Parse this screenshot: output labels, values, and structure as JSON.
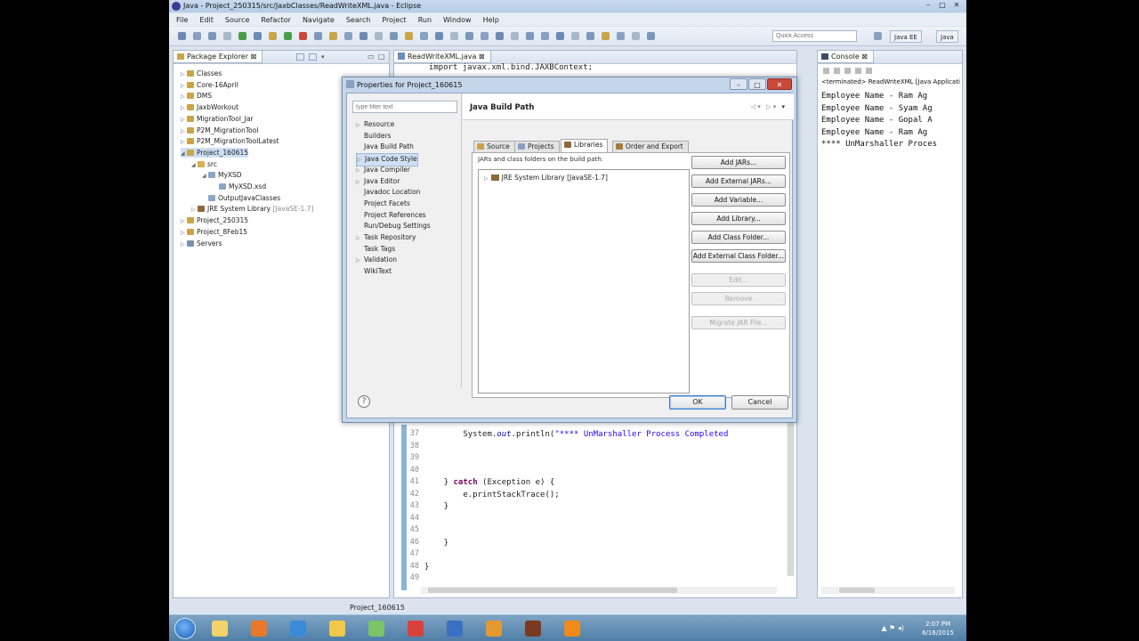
{
  "window": {
    "title": "Java - Project_250315/src/JaxbClasses/ReadWriteXML.java - Eclipse",
    "controls": {
      "minimize": "–",
      "maximize": "□",
      "close": "✕"
    }
  },
  "menu": [
    "File",
    "Edit",
    "Source",
    "Refactor",
    "Navigate",
    "Search",
    "Project",
    "Run",
    "Window",
    "Help"
  ],
  "toolbar": {
    "quick_access_placeholder": "Quick Access",
    "perspectives": [
      "Java EE",
      "Java"
    ]
  },
  "package_explorer": {
    "title": "Package Explorer",
    "items": [
      {
        "label": "Classes",
        "level": 0,
        "arrow": "▷",
        "icon": "project-icon"
      },
      {
        "label": "Core-16April",
        "level": 0,
        "arrow": "▷",
        "icon": "project-icon"
      },
      {
        "label": "DMS",
        "level": 0,
        "arrow": "▷",
        "icon": "project-icon"
      },
      {
        "label": "JaxbWorkout",
        "level": 0,
        "arrow": "▷",
        "icon": "project-icon"
      },
      {
        "label": "MigrationTool_Jar",
        "level": 0,
        "arrow": "▷",
        "icon": "project-icon"
      },
      {
        "label": "P2M_MigrationTool",
        "level": 0,
        "arrow": "▷",
        "icon": "project-icon"
      },
      {
        "label": "P2M_MigrationToolLatest",
        "level": 0,
        "arrow": "▷",
        "icon": "project-icon"
      },
      {
        "label": "Project_160615",
        "level": 0,
        "arrow": "◢",
        "icon": "project-icon",
        "selected": true
      },
      {
        "label": "src",
        "level": 1,
        "arrow": "◢",
        "icon": "source-folder-icon"
      },
      {
        "label": "MyXSD",
        "level": 2,
        "arrow": "◢",
        "icon": "package-icon"
      },
      {
        "label": "MyXSD.xsd",
        "level": 3,
        "arrow": "",
        "icon": "file-icon"
      },
      {
        "label": "OutputJavaClasses",
        "level": 2,
        "arrow": "",
        "icon": "package-icon"
      },
      {
        "label": "JRE System Library",
        "suffix": "[JavaSE-1.7]",
        "level": 1,
        "arrow": "▷",
        "icon": "library-icon"
      },
      {
        "label": "Project_250315",
        "level": 0,
        "arrow": "▷",
        "icon": "project-icon"
      },
      {
        "label": "Project_8Feb15",
        "level": 0,
        "arrow": "▷",
        "icon": "project-icon"
      },
      {
        "label": "Servers",
        "level": 0,
        "arrow": "▷",
        "icon": "server-icon"
      }
    ]
  },
  "editor": {
    "tab_label": "ReadWriteXML.java",
    "top_line": "  import javax.xml.bind.JAXBContext;",
    "lines": [
      {
        "n": "37",
        "parts": [
          [
            "",
            "        System."
          ],
          [
            "fld",
            "out"
          ],
          [
            "",
            ".println("
          ],
          [
            "str",
            "\"**** UnMarshaller Process Completed"
          ]
        ]
      },
      {
        "n": "38",
        "parts": []
      },
      {
        "n": "39",
        "parts": []
      },
      {
        "n": "40",
        "parts": []
      },
      {
        "n": "41",
        "parts": [
          [
            "",
            "    } "
          ],
          [
            "kw",
            "catch"
          ],
          [
            "",
            " (Exception e) {"
          ]
        ]
      },
      {
        "n": "42",
        "parts": [
          [
            "",
            "        e.printStackTrace();"
          ]
        ]
      },
      {
        "n": "43",
        "parts": [
          [
            "",
            "    }"
          ]
        ]
      },
      {
        "n": "44",
        "parts": []
      },
      {
        "n": "45",
        "parts": []
      },
      {
        "n": "46",
        "parts": [
          [
            "",
            "    }"
          ]
        ]
      },
      {
        "n": "47",
        "parts": []
      },
      {
        "n": "48",
        "parts": [
          [
            "",
            "}"
          ]
        ]
      },
      {
        "n": "49",
        "parts": []
      }
    ]
  },
  "console": {
    "title": "Console",
    "header": "<terminated> ReadWriteXML [Java Applicati",
    "lines": [
      "Employee Name - Ram Ag",
      "Employee Name - Syam Ag",
      "Employee Name - Gopal A",
      "Employee Name - Ram Ag",
      "**** UnMarshaller Proces"
    ]
  },
  "status_bar": {
    "text": "Project_160615"
  },
  "taskbar": {
    "time": "2:07 PM",
    "date": "6/16/2015"
  },
  "dialog": {
    "title": "Properties for Project_160615",
    "filter_placeholder": "type filter text",
    "categories": [
      {
        "label": "Resource",
        "arrow": "▷"
      },
      {
        "label": "Builders",
        "arrow": ""
      },
      {
        "label": "Java Build Path",
        "arrow": ""
      },
      {
        "label": "Java Code Style",
        "arrow": "▷",
        "selected": true
      },
      {
        "label": "Java Compiler",
        "arrow": "▷"
      },
      {
        "label": "Java Editor",
        "arrow": "▷"
      },
      {
        "label": "Javadoc Location",
        "arrow": ""
      },
      {
        "label": "Project Facets",
        "arrow": ""
      },
      {
        "label": "Project References",
        "arrow": ""
      },
      {
        "label": "Run/Debug Settings",
        "arrow": ""
      },
      {
        "label": "Task Repository",
        "arrow": "▷"
      },
      {
        "label": "Task Tags",
        "arrow": ""
      },
      {
        "label": "Validation",
        "arrow": "▷"
      },
      {
        "label": "WikiText",
        "arrow": ""
      }
    ],
    "page_title": "Java Build Path",
    "tabs": [
      "Source",
      "Projects",
      "Libraries",
      "Order and Export"
    ],
    "active_tab": "Libraries",
    "panel_label": "JARs and class folders on the build path:",
    "library_item": "JRE System Library [JavaSE-1.7]",
    "buttons": [
      {
        "label": "Add JARs...",
        "enabled": true
      },
      {
        "label": "Add External JARs...",
        "enabled": true
      },
      {
        "label": "Add Variable...",
        "enabled": true
      },
      {
        "label": "Add Library...",
        "enabled": true
      },
      {
        "label": "Add Class Folder...",
        "enabled": true
      },
      {
        "label": "Add External Class Folder...",
        "enabled": true
      },
      {
        "label": "Edit...",
        "enabled": false
      },
      {
        "label": "Remove",
        "enabled": false
      },
      {
        "label": "Migrate JAR File...",
        "enabled": false
      }
    ],
    "help": "?",
    "ok": "OK",
    "cancel": "Cancel"
  },
  "colors": {
    "selection": "#cfe0f5",
    "keyword": "#7f0055",
    "string": "#2a00ff"
  }
}
